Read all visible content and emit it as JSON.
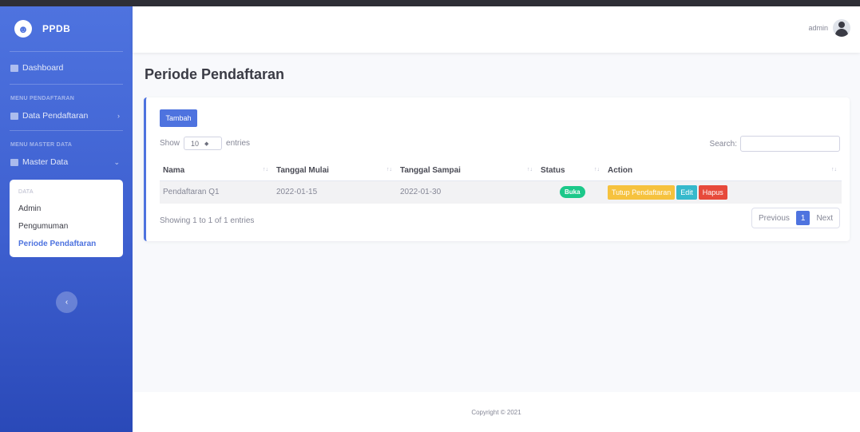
{
  "brand": {
    "name": "PPDB",
    "logo_icon": "smile-icon"
  },
  "sidebar": {
    "dashboard": "Dashboard",
    "heading_pendaftaran": "MENU PENDAFTARAN",
    "data_pendaftaran": "Data Pendaftaran",
    "heading_master": "MENU MASTER DATA",
    "master_data": "Master Data",
    "submenu": {
      "heading": "DATA",
      "items": [
        "Admin",
        "Pengumuman",
        "Periode Pendaftaran"
      ]
    }
  },
  "topbar": {
    "user_name": "admin"
  },
  "page": {
    "title": "Periode Pendaftaran"
  },
  "card": {
    "add_button": "Tambah",
    "show_label": "Show",
    "entries_value": "10",
    "entries_label": "entries",
    "search_label": "Search:",
    "table": {
      "headers": [
        "Nama",
        "Tanggal Mulai",
        "Tanggal Sampai",
        "Status",
        "Action"
      ],
      "rows": [
        {
          "nama": "Pendaftaran Q1",
          "tanggal_mulai": "2022-01-15",
          "tanggal_sampai": "2022-01-30",
          "status": "Buka",
          "actions": {
            "tutup": "Tutup Pendaftaran",
            "edit": "Edit",
            "hapus": "Hapus"
          }
        }
      ]
    },
    "info": "Showing 1 to 1 of 1 entries",
    "pagination": {
      "previous": "Previous",
      "current": "1",
      "next": "Next"
    }
  },
  "footer": {
    "copyright": "Copyright © 2021"
  },
  "colors": {
    "primary": "#4e73df",
    "success": "#1cc88a",
    "warning": "#f6c23e",
    "info": "#36b9cc",
    "danger": "#e74a3b"
  }
}
